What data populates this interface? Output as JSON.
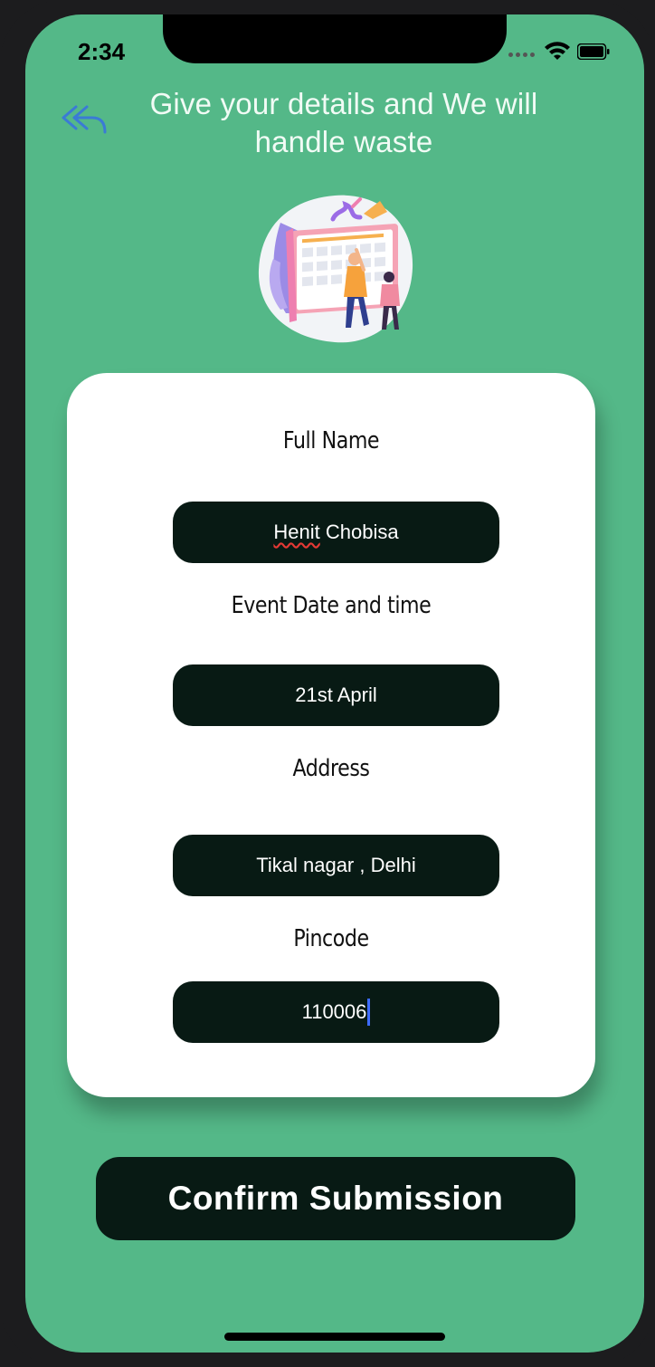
{
  "status_bar": {
    "time": "2:34"
  },
  "header": {
    "title_line1": "Give your details and We will",
    "title_line2": "handle waste"
  },
  "form": {
    "full_name": {
      "label": "Full Name",
      "value": "Henit Chobisa",
      "value_first": "Henit",
      "value_rest": " Chobisa"
    },
    "event_date": {
      "label": "Event Date and time",
      "value": "21st April"
    },
    "address": {
      "label": "Address",
      "value": "Tikal nagar , Delhi"
    },
    "pincode": {
      "label": "Pincode",
      "value": "110006"
    }
  },
  "confirm_button": {
    "label": "Confirm Submission"
  },
  "colors": {
    "background": "#54b888",
    "input_bg": "#081a14",
    "card": "#ffffff",
    "back_icon": "#3a7bd5",
    "caret": "#3d6cff"
  },
  "icons": {
    "back": "double-reply-arrow-icon",
    "wifi": "wifi-icon",
    "battery": "battery-icon",
    "signal": "signal-icon"
  }
}
